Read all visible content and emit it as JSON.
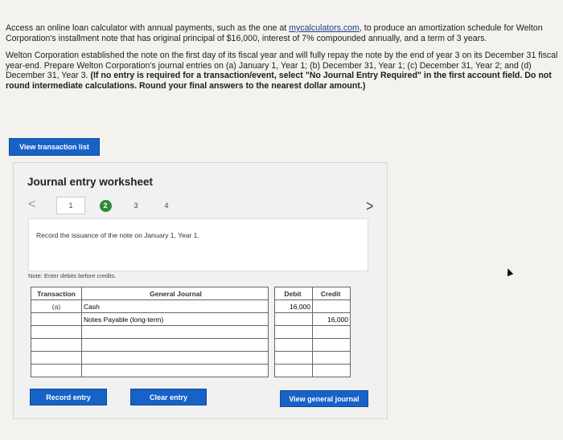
{
  "intro": {
    "p1_before_link": "Access an online loan calculator with annual payments, such as the one at ",
    "p1_link": "mycalculators.com",
    "p1_after_link": ", to produce an amortization schedule for Welton Corporation's installment note that has original principal of $16,000, interest of 7% compounded annually, and a term of 3 years.",
    "p2_plain": "Welton Corporation established the note on the first day of its fiscal year and will fully repay the note by the end of year 3 on its December 31 fiscal year-end. Prepare Welton Corporation's journal entries on (a) January 1, Year 1; (b) December 31, Year 1; (c) December 31, Year 2; and (d) December 31, Year 3. ",
    "p2_bold": "(If no entry is required for a transaction/event, select \"No Journal Entry Required\" in the first account field. Do not round intermediate calculations. Round your final answers to the nearest dollar amount.)"
  },
  "buttons": {
    "view_transaction_list": "View transaction list",
    "record_entry": "Record entry",
    "clear_entry": "Clear entry",
    "view_general_journal": "View general journal"
  },
  "worksheet": {
    "title": "Journal entry worksheet",
    "prev": "<",
    "next": ">",
    "steps": [
      "1",
      "2",
      "3",
      "4"
    ],
    "active_step": "2",
    "instruction": "Record the issuance of the note on January 1, Year 1.",
    "note": "Note: Enter debits before credits."
  },
  "journal": {
    "headers": {
      "transaction": "Transaction",
      "general_journal": "General Journal",
      "debit": "Debit",
      "credit": "Credit"
    },
    "rows": [
      {
        "transaction": "(a)",
        "account": "Cash",
        "debit": "16,000",
        "credit": ""
      },
      {
        "transaction": "",
        "account": "Notes Payable (long-term)",
        "debit": "",
        "credit": "16,000"
      },
      {
        "transaction": "",
        "account": "",
        "debit": "",
        "credit": ""
      },
      {
        "transaction": "",
        "account": "",
        "debit": "",
        "credit": ""
      },
      {
        "transaction": "",
        "account": "",
        "debit": "",
        "credit": ""
      },
      {
        "transaction": "",
        "account": "",
        "debit": "",
        "credit": ""
      }
    ]
  },
  "colors": {
    "accent": "#1762c6",
    "active_step": "#2e8a3a"
  }
}
